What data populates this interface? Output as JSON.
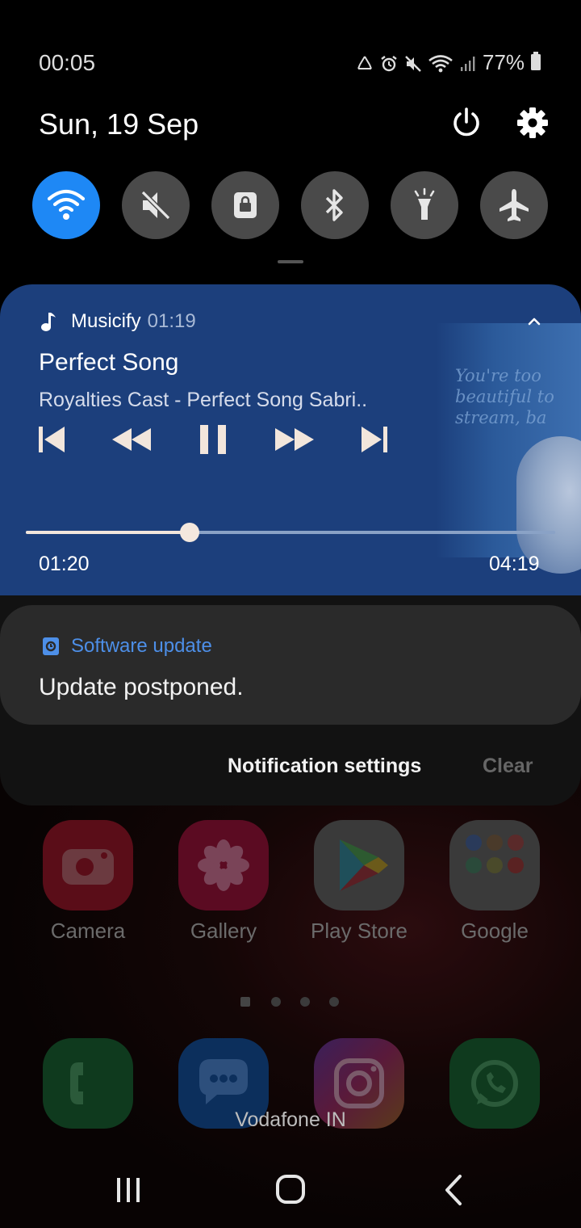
{
  "status_bar": {
    "time": "00:05",
    "battery_percent": "77%",
    "icons": [
      "recycle-icon",
      "alarm-icon",
      "mute-icon",
      "wifi-icon",
      "signal-icon",
      "battery-icon"
    ]
  },
  "header": {
    "date": "Sun, 19 Sep"
  },
  "quick_settings": [
    {
      "name": "wifi",
      "icon": "wifi-icon",
      "on": true
    },
    {
      "name": "sound",
      "icon": "mute-icon",
      "on": false
    },
    {
      "name": "screen-lock",
      "icon": "lock-icon",
      "on": false
    },
    {
      "name": "bluetooth",
      "icon": "bluetooth-icon",
      "on": false
    },
    {
      "name": "flashlight",
      "icon": "flashlight-icon",
      "on": false
    },
    {
      "name": "airplane",
      "icon": "airplane-icon",
      "on": false
    }
  ],
  "media": {
    "app_name": "Musicify",
    "app_time": "01:19",
    "title": "Perfect Song",
    "artist": "Royalties Cast - Perfect Song Sabri..",
    "art_text": "You're too beautiful to stream, ba",
    "elapsed": "01:20",
    "total": "04:19",
    "progress_fraction": 0.309,
    "accent_color": "#1c3f7c"
  },
  "software_update": {
    "app_name": "Software update",
    "message": "Update postponed.",
    "accent_color": "#4d8fe8"
  },
  "panel_actions": {
    "settings_label": "Notification settings",
    "clear_label": "Clear"
  },
  "home": {
    "apps": [
      "Camera",
      "Gallery",
      "Play Store",
      "Google"
    ],
    "dock": [
      "phone-icon",
      "messages-icon",
      "instagram-icon",
      "whatsapp-icon"
    ],
    "carrier": "Vodafone IN"
  }
}
